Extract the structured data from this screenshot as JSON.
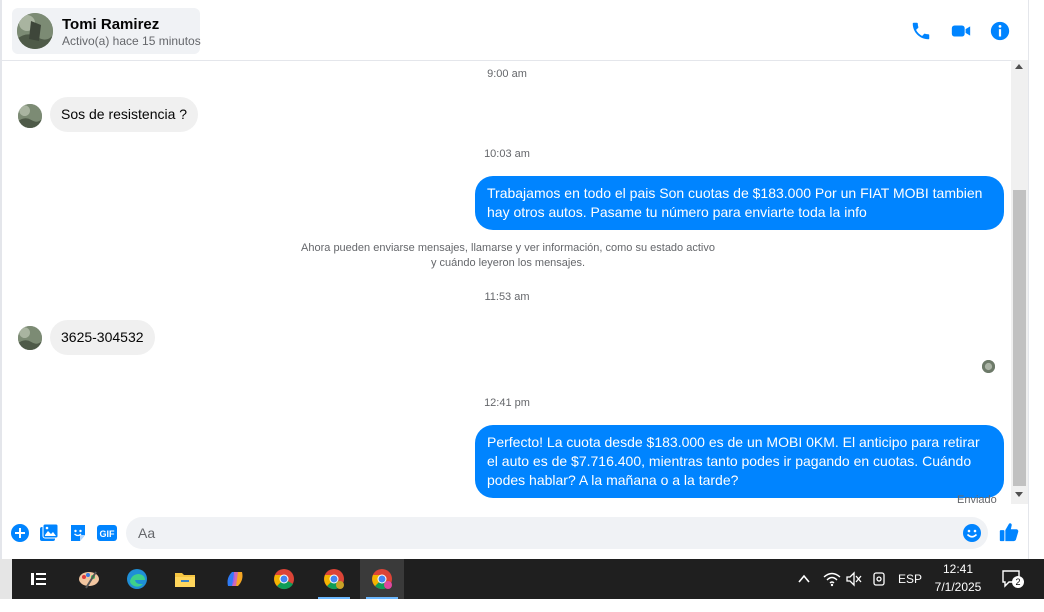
{
  "header": {
    "contact_name": "Tomi Ramirez",
    "contact_status": "Activo(a) hace 15 minutos",
    "icons": [
      "phone-call-icon",
      "video-call-icon",
      "info-icon"
    ]
  },
  "colors": {
    "accent": "#0084ff",
    "incoming_bubble": "#f0f0f0",
    "muted_text": "#65676b",
    "taskbar": "#1f1f1f"
  },
  "messages": {
    "ts1": "9:00 am",
    "m1": "Sos de resistencia ?",
    "ts2": "10:03 am",
    "m2": "Trabajamos en todo el pais Son cuotas de $183.000 Por un FIAT MOBI tambien hay otros autos. Pasame tu número para enviarte toda la info",
    "notice_line1": "Ahora pueden enviarse mensajes, llamarse y ver información, como su estado activo",
    "notice_line2": "y cuándo leyeron los mensajes.",
    "ts3": "11:53 am",
    "m3": "3625-304532",
    "ts4": "12:41 pm",
    "m4": "Perfecto! La cuota desde $183.000 es de un MOBI 0KM. El anticipo para retirar el auto es de $7.716.400, mientras tanto podes ir pagando en cuotas. Cuándo podes hablar? A la mañana o a la tarde?",
    "sent_status": "Enviado"
  },
  "composer": {
    "placeholder": "Aa",
    "icons": [
      "plus-icon",
      "photo-icon",
      "sticker-icon",
      "gif-icon",
      "emoji-icon",
      "like-icon"
    ],
    "gif_label": "GIF"
  },
  "taskbar": {
    "apps": [
      "task-view-icon",
      "paint-icon",
      "edge-icon",
      "file-explorer-icon",
      "copilot-icon",
      "chrome-icon",
      "chrome-profile-icon",
      "chrome-active-icon"
    ],
    "language": "ESP",
    "time": "12:41",
    "date": "7/1/2025",
    "notification_count": "2"
  }
}
